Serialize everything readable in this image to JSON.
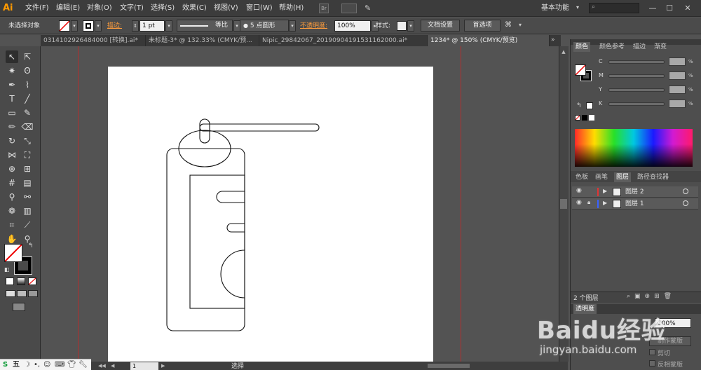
{
  "app": {
    "logo": "Ai"
  },
  "menubar": {
    "items": [
      "文件(F)",
      "编辑(E)",
      "对象(O)",
      "文字(T)",
      "选择(S)",
      "效果(C)",
      "视图(V)",
      "窗口(W)",
      "帮助(H)"
    ],
    "bridge_label": "Br",
    "workspace_label": "基本功能",
    "window_controls": [
      "—",
      "☐",
      "✕"
    ]
  },
  "controlbar": {
    "selection_status": "未选择对象",
    "stroke_label": "描边:",
    "stroke_weight": "1 pt",
    "profile_label": "等比",
    "brush_label": "5 点圆形",
    "opacity_label": "不透明度:",
    "opacity_value": "100%",
    "style_label": "样式:",
    "doc_setup_button": "文档设置",
    "preferences_button": "首选项"
  },
  "tabs": [
    {
      "label": "0314102926484000 [转换].ai*",
      "active": false
    },
    {
      "label": "未标题-3* @ 132.33% (CMYK/预...",
      "active": false
    },
    {
      "label": "Nipic_29842067_20190904191531162000.ai*",
      "active": false
    },
    {
      "label": "1234* @ 150% (CMYK/预览)",
      "active": true
    }
  ],
  "rightpanel": {
    "color_tabs": [
      "颜色",
      "颜色参考",
      "描边",
      "渐变"
    ],
    "cmyk": [
      {
        "label": "C",
        "unit": "%"
      },
      {
        "label": "M",
        "unit": "%"
      },
      {
        "label": "Y",
        "unit": "%"
      },
      {
        "label": "K",
        "unit": "%"
      }
    ],
    "lower_tabs": [
      "色板",
      "画笔",
      "图层",
      "路径查找器"
    ],
    "layers": [
      {
        "name": "图层 2",
        "color": "#e03535"
      },
      {
        "name": "图层 1",
        "color": "#3a62ff"
      }
    ],
    "layers_count": "2 个图层",
    "transparency_tab": "透明度",
    "transparency_value": "100%",
    "make_mask_button": "制作蒙版",
    "clip_label": "剪切",
    "invert_mask_label": "反相蒙版"
  },
  "status": {
    "zoom": "1",
    "tool_label": "选择"
  },
  "ime": {
    "label": "五"
  },
  "watermark": {
    "brand": "Baidu经验",
    "url": "jingyan.baidu.com"
  }
}
